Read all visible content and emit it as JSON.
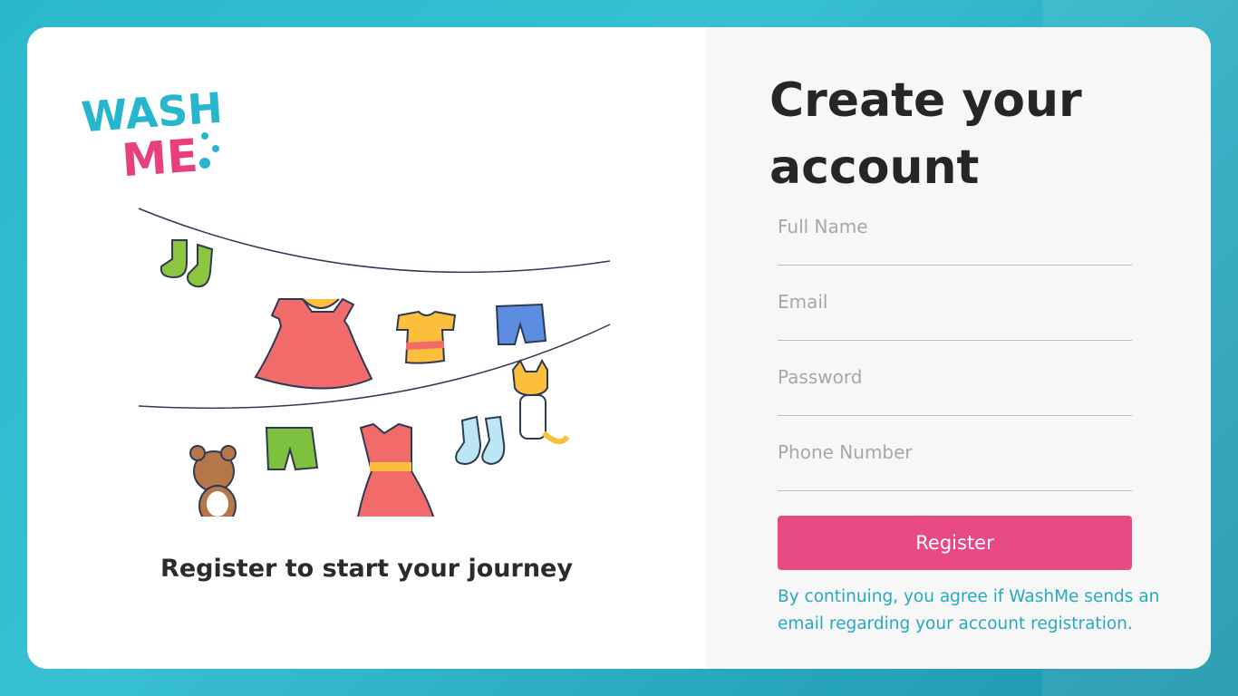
{
  "brand": {
    "logo_line1": "WASH",
    "logo_line2": "ME",
    "color_primary": "#27b6cf",
    "color_secondary": "#e8407e"
  },
  "left_panel": {
    "tagline": "Register to start your journey"
  },
  "form": {
    "title": "Create your account",
    "full_name_placeholder": "Full Name",
    "email_placeholder": "Email",
    "password_placeholder": "Password",
    "phone_placeholder": "Phone Number",
    "register_label": "Register",
    "note": "By continuing, you agree if WashMe sends an email regarding your account registration."
  },
  "colors": {
    "accent": "#e74983",
    "link": "#27a9c2",
    "background": "#2ab8cc"
  }
}
